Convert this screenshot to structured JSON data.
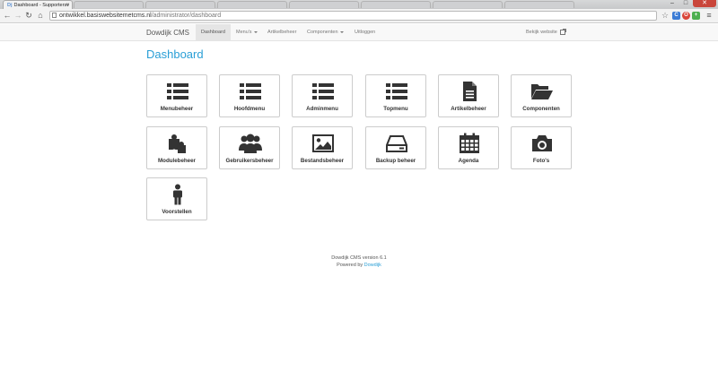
{
  "browser": {
    "active_tab_title": "Dashboard - Supportersv",
    "tab_favicon": "Dj",
    "address_host": "ontwikkel.basiswebsitemetcms.nl",
    "address_path": "/administrator/dashboard"
  },
  "navbar": {
    "brand": "Dowdijk CMS",
    "items": [
      {
        "label": "Dashboard",
        "active": true
      },
      {
        "label": "Menu's",
        "dropdown": true
      },
      {
        "label": "Artikelbeheer"
      },
      {
        "label": "Componenten",
        "dropdown": true
      },
      {
        "label": "Uitloggen"
      }
    ],
    "right_link": "Bekijk website"
  },
  "main": {
    "title": "Dashboard",
    "tiles": [
      {
        "label": "Menubeheer",
        "icon": "list-icon"
      },
      {
        "label": "Hoofdmenu",
        "icon": "list-icon"
      },
      {
        "label": "Adminmenu",
        "icon": "list-icon"
      },
      {
        "label": "Topmenu",
        "icon": "list-icon"
      },
      {
        "label": "Artikelbeheer",
        "icon": "file-text-icon"
      },
      {
        "label": "Componenten",
        "icon": "folder-open-icon"
      },
      {
        "label": "Modulebeheer",
        "icon": "puzzle-icon"
      },
      {
        "label": "Gebruikersbeheer",
        "icon": "users-icon"
      },
      {
        "label": "Bestandsbeheer",
        "icon": "picture-icon"
      },
      {
        "label": "Backup beheer",
        "icon": "hdd-icon"
      },
      {
        "label": "Agenda",
        "icon": "calendar-icon"
      },
      {
        "label": "Foto's",
        "icon": "camera-icon"
      },
      {
        "label": "Voorstellen",
        "icon": "male-icon"
      }
    ]
  },
  "footer": {
    "version": "Dowdijk CMS version 6.1",
    "powered_by": "Powered by",
    "powered_link": "Dowdijk"
  },
  "colors": {
    "accent": "#2a9fd6",
    "icon": "#333333"
  }
}
